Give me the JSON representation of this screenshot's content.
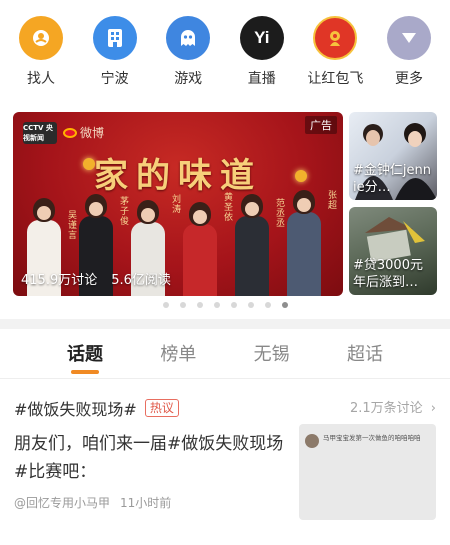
{
  "quick_icons": [
    {
      "label": "找人",
      "icon": "magnifier-person-icon",
      "color": "#f5a623"
    },
    {
      "label": "宁波",
      "icon": "building-icon",
      "color": "#3d8de8"
    },
    {
      "label": "游戏",
      "icon": "game-ghost-icon",
      "color": "#3f86e0"
    },
    {
      "label": "直播",
      "icon": "live-yi-icon",
      "color": "#1c1c1c",
      "glyph": "Yi"
    },
    {
      "label": "让红包飞",
      "icon": "red-envelope-icon",
      "color": "#e03626"
    },
    {
      "label": "更多",
      "icon": "chevron-down-icon",
      "color": "#a9a9c9"
    }
  ],
  "main_banner": {
    "ad_label": "广告",
    "logo_text": "CCTV 央视新闻",
    "weibo_text": "微博",
    "title": "家的味道",
    "names": [
      "吴谨言",
      "茅子俊",
      "刘涛",
      "黄圣依",
      "范丞丞",
      "张超"
    ],
    "discussions": "415.9万讨论",
    "reads": "5.6亿阅读"
  },
  "side_cards": [
    {
      "caption": "#金钟仁jennie分…"
    },
    {
      "caption": "#贷3000元年后涨到…"
    }
  ],
  "carousel": {
    "count": 8,
    "active_index": 7
  },
  "tabs": [
    {
      "label": "话题",
      "active": true
    },
    {
      "label": "榜单",
      "active": false
    },
    {
      "label": "无锡",
      "active": false
    },
    {
      "label": "超话",
      "active": false
    }
  ],
  "topic": {
    "title": "#做饭失败现场#",
    "badge": "热议",
    "count": "2.1万条讨论",
    "body": "朋友们，咱们来一届#做饭失败现场#比赛吧：",
    "author": "@回忆专用小马甲",
    "time": "11小时前",
    "thumb_text": "马甲宝宝发第一次做鱼的咱咱咱咱"
  },
  "colors": {
    "accent": "#f08a24",
    "hot": "#e05a4a"
  }
}
